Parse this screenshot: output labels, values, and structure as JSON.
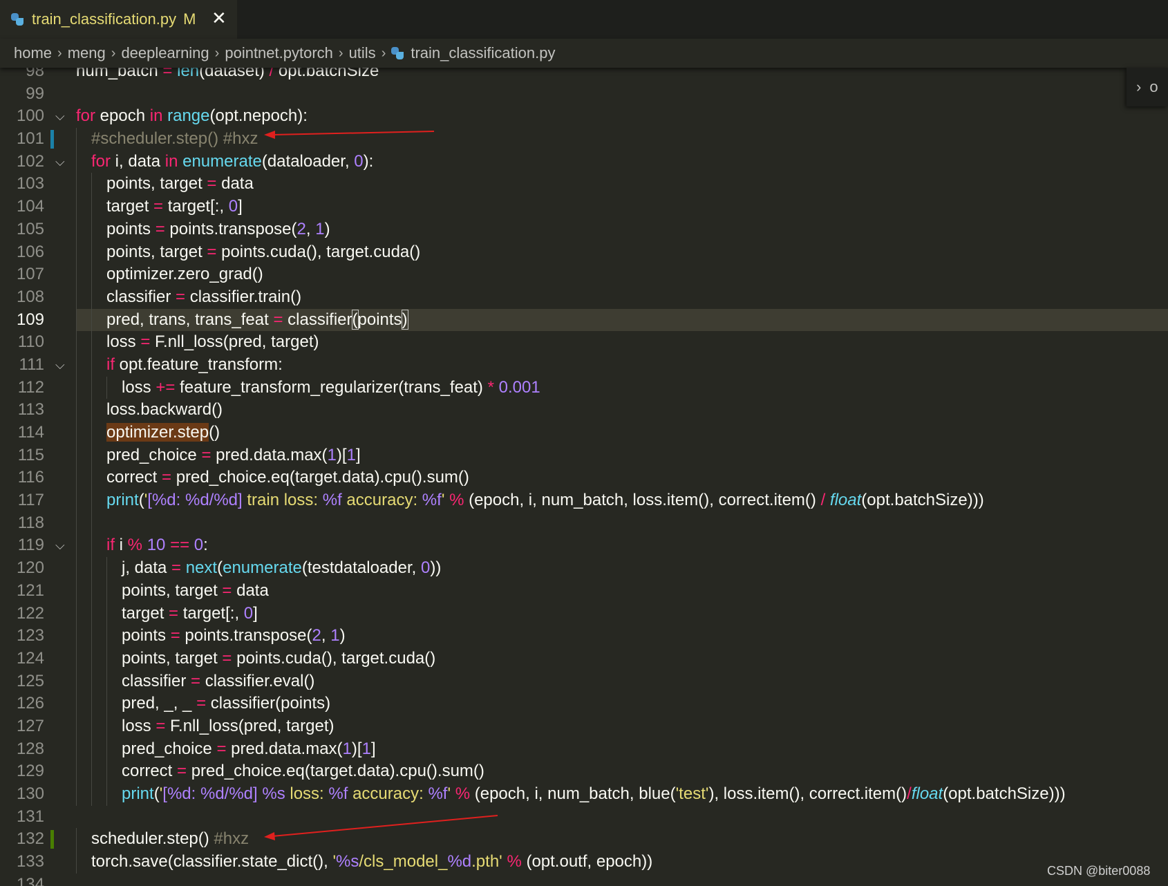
{
  "tab": {
    "title": "train_classification.py",
    "modified": "M",
    "close": "✕"
  },
  "breadcrumb": [
    "home",
    "meng",
    "deeplearning",
    "pointnet.pytorch",
    "utils",
    "train_classification.py"
  ],
  "minimap_label": "o",
  "watermark": "CSDN @biter0088",
  "colors": {
    "background": "#272822",
    "keyword": "#f92672",
    "function": "#66d9ef",
    "number": "#ae81ff",
    "string": "#e6db74",
    "comment": "#88846f",
    "arrow": "#e0201e"
  },
  "lines": [
    {
      "n": "98",
      "indent": 0,
      "tokens": [
        [
          "plain",
          "num_batch "
        ],
        [
          "op",
          "="
        ],
        [
          "plain",
          " "
        ],
        [
          "fn",
          "len"
        ],
        [
          "plain",
          "(dataset) "
        ],
        [
          "op",
          "/"
        ],
        [
          "plain",
          " opt.batchSize"
        ]
      ]
    },
    {
      "n": "99",
      "indent": 0,
      "tokens": []
    },
    {
      "n": "100",
      "indent": 0,
      "fold": true,
      "tokens": [
        [
          "kw",
          "for"
        ],
        [
          "plain",
          " epoch "
        ],
        [
          "kw",
          "in"
        ],
        [
          "plain",
          " "
        ],
        [
          "fn",
          "range"
        ],
        [
          "plain",
          "(opt.nepoch):"
        ]
      ]
    },
    {
      "n": "101",
      "indent": 1,
      "mark": "mod",
      "tokens": [
        [
          "cm",
          "#scheduler.step() #hxz"
        ]
      ]
    },
    {
      "n": "102",
      "indent": 1,
      "fold": true,
      "tokens": [
        [
          "kw",
          "for"
        ],
        [
          "plain",
          " i, data "
        ],
        [
          "kw",
          "in"
        ],
        [
          "plain",
          " "
        ],
        [
          "fn",
          "enumerate"
        ],
        [
          "plain",
          "(dataloader, "
        ],
        [
          "num",
          "0"
        ],
        [
          "plain",
          "):"
        ]
      ]
    },
    {
      "n": "103",
      "indent": 2,
      "tokens": [
        [
          "plain",
          "points, target "
        ],
        [
          "op",
          "="
        ],
        [
          "plain",
          " data"
        ]
      ]
    },
    {
      "n": "104",
      "indent": 2,
      "tokens": [
        [
          "plain",
          "target "
        ],
        [
          "op",
          "="
        ],
        [
          "plain",
          " target[:, "
        ],
        [
          "num",
          "0"
        ],
        [
          "plain",
          "]"
        ]
      ]
    },
    {
      "n": "105",
      "indent": 2,
      "tokens": [
        [
          "plain",
          "points "
        ],
        [
          "op",
          "="
        ],
        [
          "plain",
          " points.transpose("
        ],
        [
          "num",
          "2"
        ],
        [
          "plain",
          ", "
        ],
        [
          "num",
          "1"
        ],
        [
          "plain",
          ")"
        ]
      ]
    },
    {
      "n": "106",
      "indent": 2,
      "tokens": [
        [
          "plain",
          "points, target "
        ],
        [
          "op",
          "="
        ],
        [
          "plain",
          " points.cuda(), target.cuda()"
        ]
      ]
    },
    {
      "n": "107",
      "indent": 2,
      "tokens": [
        [
          "plain",
          "optimizer.zero_grad()"
        ]
      ]
    },
    {
      "n": "108",
      "indent": 2,
      "tokens": [
        [
          "plain",
          "classifier "
        ],
        [
          "op",
          "="
        ],
        [
          "plain",
          " classifier.train()"
        ]
      ]
    },
    {
      "n": "109",
      "indent": 2,
      "current": true,
      "tokens": [
        [
          "plain",
          "pred, trans, trans_feat "
        ],
        [
          "op",
          "="
        ],
        [
          "plain",
          " classifier"
        ],
        [
          "bracket",
          "("
        ],
        [
          "plain",
          "points"
        ],
        [
          "bracket",
          ")"
        ]
      ]
    },
    {
      "n": "110",
      "indent": 2,
      "tokens": [
        [
          "plain",
          "loss "
        ],
        [
          "op",
          "="
        ],
        [
          "plain",
          " F.nll_loss(pred, target)"
        ]
      ]
    },
    {
      "n": "111",
      "indent": 2,
      "fold": true,
      "tokens": [
        [
          "kw",
          "if"
        ],
        [
          "plain",
          " opt.feature_transform:"
        ]
      ]
    },
    {
      "n": "112",
      "indent": 3,
      "tokens": [
        [
          "plain",
          "loss "
        ],
        [
          "op",
          "+="
        ],
        [
          "plain",
          " feature_transform_regularizer(trans_feat) "
        ],
        [
          "op",
          "*"
        ],
        [
          "plain",
          " "
        ],
        [
          "num",
          "0.001"
        ]
      ]
    },
    {
      "n": "113",
      "indent": 2,
      "tokens": [
        [
          "plain",
          "loss.backward()"
        ]
      ]
    },
    {
      "n": "114",
      "indent": 2,
      "tokens": [
        [
          "wordhl",
          "optimizer.step"
        ],
        [
          "plain",
          "()"
        ]
      ]
    },
    {
      "n": "115",
      "indent": 2,
      "tokens": [
        [
          "plain",
          "pred_choice "
        ],
        [
          "op",
          "="
        ],
        [
          "plain",
          " pred.data.max("
        ],
        [
          "num",
          "1"
        ],
        [
          "plain",
          ")["
        ],
        [
          "num",
          "1"
        ],
        [
          "plain",
          "]"
        ]
      ]
    },
    {
      "n": "116",
      "indent": 2,
      "tokens": [
        [
          "plain",
          "correct "
        ],
        [
          "op",
          "="
        ],
        [
          "plain",
          " pred_choice.eq(target.data).cpu().sum()"
        ]
      ]
    },
    {
      "n": "117",
      "indent": 2,
      "tokens": [
        [
          "fn",
          "print"
        ],
        [
          "plain",
          "("
        ],
        [
          "str",
          "'"
        ],
        [
          "num",
          "[%d: %d/%d]"
        ],
        [
          "str",
          " train loss: "
        ],
        [
          "num",
          "%f"
        ],
        [
          "str",
          " accuracy: "
        ],
        [
          "num",
          "%f"
        ],
        [
          "str",
          "'"
        ],
        [
          "plain",
          " "
        ],
        [
          "op",
          "%"
        ],
        [
          "plain",
          " (epoch, i, num_batch, loss.item(), correct.item() "
        ],
        [
          "op",
          "/"
        ],
        [
          "plain",
          " "
        ],
        [
          "it",
          "float"
        ],
        [
          "plain",
          "(opt.batchSize)))"
        ]
      ]
    },
    {
      "n": "118",
      "indent": 2,
      "tokens": []
    },
    {
      "n": "119",
      "indent": 2,
      "fold": true,
      "tokens": [
        [
          "kw",
          "if"
        ],
        [
          "plain",
          " i "
        ],
        [
          "op",
          "%"
        ],
        [
          "plain",
          " "
        ],
        [
          "num",
          "10"
        ],
        [
          "plain",
          " "
        ],
        [
          "op",
          "=="
        ],
        [
          "plain",
          " "
        ],
        [
          "num",
          "0"
        ],
        [
          "plain",
          ":"
        ]
      ]
    },
    {
      "n": "120",
      "indent": 3,
      "tokens": [
        [
          "plain",
          "j, data "
        ],
        [
          "op",
          "="
        ],
        [
          "plain",
          " "
        ],
        [
          "fn",
          "next"
        ],
        [
          "plain",
          "("
        ],
        [
          "fn",
          "enumerate"
        ],
        [
          "plain",
          "(testdataloader, "
        ],
        [
          "num",
          "0"
        ],
        [
          "plain",
          "))"
        ]
      ]
    },
    {
      "n": "121",
      "indent": 3,
      "tokens": [
        [
          "plain",
          "points, target "
        ],
        [
          "op",
          "="
        ],
        [
          "plain",
          " data"
        ]
      ]
    },
    {
      "n": "122",
      "indent": 3,
      "tokens": [
        [
          "plain",
          "target "
        ],
        [
          "op",
          "="
        ],
        [
          "plain",
          " target[:, "
        ],
        [
          "num",
          "0"
        ],
        [
          "plain",
          "]"
        ]
      ]
    },
    {
      "n": "123",
      "indent": 3,
      "tokens": [
        [
          "plain",
          "points "
        ],
        [
          "op",
          "="
        ],
        [
          "plain",
          " points.transpose("
        ],
        [
          "num",
          "2"
        ],
        [
          "plain",
          ", "
        ],
        [
          "num",
          "1"
        ],
        [
          "plain",
          ")"
        ]
      ]
    },
    {
      "n": "124",
      "indent": 3,
      "tokens": [
        [
          "plain",
          "points, target "
        ],
        [
          "op",
          "="
        ],
        [
          "plain",
          " points.cuda(), target.cuda()"
        ]
      ]
    },
    {
      "n": "125",
      "indent": 3,
      "tokens": [
        [
          "plain",
          "classifier "
        ],
        [
          "op",
          "="
        ],
        [
          "plain",
          " classifier.eval()"
        ]
      ]
    },
    {
      "n": "126",
      "indent": 3,
      "tokens": [
        [
          "plain",
          "pred, _, _ "
        ],
        [
          "op",
          "="
        ],
        [
          "plain",
          " classifier(points)"
        ]
      ]
    },
    {
      "n": "127",
      "indent": 3,
      "tokens": [
        [
          "plain",
          "loss "
        ],
        [
          "op",
          "="
        ],
        [
          "plain",
          " F.nll_loss(pred, target)"
        ]
      ]
    },
    {
      "n": "128",
      "indent": 3,
      "tokens": [
        [
          "plain",
          "pred_choice "
        ],
        [
          "op",
          "="
        ],
        [
          "plain",
          " pred.data.max("
        ],
        [
          "num",
          "1"
        ],
        [
          "plain",
          ")["
        ],
        [
          "num",
          "1"
        ],
        [
          "plain",
          "]"
        ]
      ]
    },
    {
      "n": "129",
      "indent": 3,
      "tokens": [
        [
          "plain",
          "correct "
        ],
        [
          "op",
          "="
        ],
        [
          "plain",
          " pred_choice.eq(target.data).cpu().sum()"
        ]
      ]
    },
    {
      "n": "130",
      "indent": 3,
      "tokens": [
        [
          "fn",
          "print"
        ],
        [
          "plain",
          "("
        ],
        [
          "str",
          "'"
        ],
        [
          "num",
          "[%d: %d/%d]"
        ],
        [
          "str",
          " "
        ],
        [
          "num",
          "%s"
        ],
        [
          "str",
          " loss: "
        ],
        [
          "num",
          "%f"
        ],
        [
          "str",
          " accuracy: "
        ],
        [
          "num",
          "%f"
        ],
        [
          "str",
          "'"
        ],
        [
          "plain",
          " "
        ],
        [
          "op",
          "%"
        ],
        [
          "plain",
          " (epoch, i, num_batch, blue("
        ],
        [
          "str",
          "'test'"
        ],
        [
          "plain",
          "), loss.item(), correct.item()"
        ],
        [
          "op",
          "/"
        ],
        [
          "it",
          "float"
        ],
        [
          "plain",
          "(opt.batchSize)))"
        ]
      ]
    },
    {
      "n": "131",
      "indent": 0,
      "tokens": []
    },
    {
      "n": "132",
      "indent": 1,
      "mark": "add",
      "tokens": [
        [
          "plain",
          "scheduler.step() "
        ],
        [
          "cm",
          "#hxz"
        ]
      ]
    },
    {
      "n": "133",
      "indent": 1,
      "tokens": [
        [
          "plain",
          "torch.save(classifier.state_dict(), "
        ],
        [
          "str",
          "'"
        ],
        [
          "num",
          "%s"
        ],
        [
          "str",
          "/cls_model_"
        ],
        [
          "num",
          "%d"
        ],
        [
          "str",
          ".pth'"
        ],
        [
          "plain",
          " "
        ],
        [
          "op",
          "%"
        ],
        [
          "plain",
          " (opt.outf, epoch))"
        ]
      ]
    },
    {
      "n": "134",
      "indent": 0,
      "tokens": []
    }
  ]
}
